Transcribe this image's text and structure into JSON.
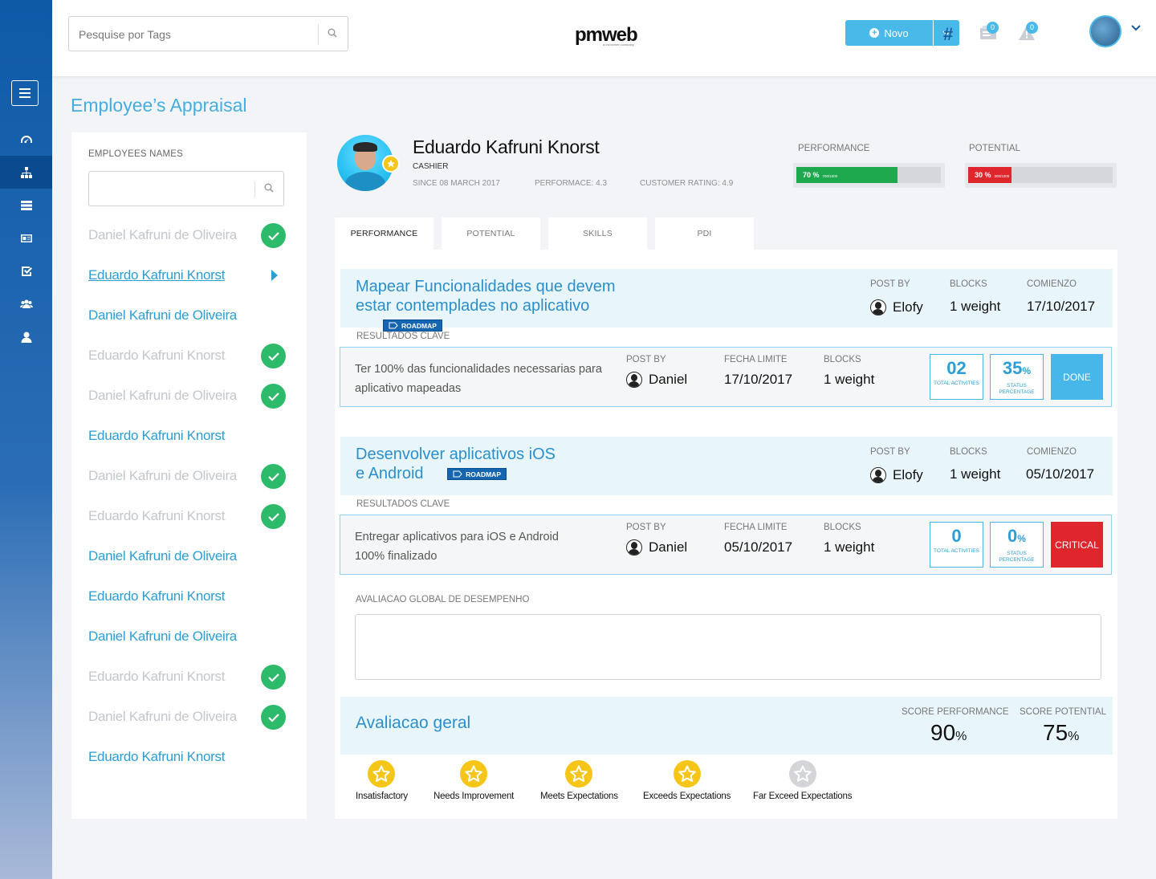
{
  "header": {
    "search_placeholder": "Pesquise por Tags",
    "logo": "pmweb",
    "logo_sub": "a Involvmen company",
    "new_button": "Novo",
    "hash": "#",
    "messages_count": "0",
    "alerts_count": "0"
  },
  "page": {
    "title": "Employee’s Appraisal"
  },
  "sidebar": {
    "items": [
      {
        "icon": "dashboard-icon"
      },
      {
        "icon": "org-chart-icon"
      },
      {
        "icon": "server-icon"
      },
      {
        "icon": "id-card-icon"
      },
      {
        "icon": "checklist-icon"
      },
      {
        "icon": "users-icon"
      },
      {
        "icon": "user-icon"
      }
    ]
  },
  "employees": {
    "label": "EMPLOYEES NAMES",
    "search_value": "",
    "list": [
      {
        "name": "Daniel Kafruni de Oliveira",
        "state": "done"
      },
      {
        "name": "Eduardo Kafruni Knorst",
        "state": "selected"
      },
      {
        "name": "Daniel Kafruni de Oliveira",
        "state": "active"
      },
      {
        "name": "Eduardo Kafruni Knorst",
        "state": "done"
      },
      {
        "name": "Daniel Kafruni de Oliveira",
        "state": "done"
      },
      {
        "name": "Eduardo Kafruni Knorst",
        "state": "active"
      },
      {
        "name": "Daniel Kafruni de Oliveira",
        "state": "done"
      },
      {
        "name": "Eduardo Kafruni Knorst",
        "state": "done"
      },
      {
        "name": "Daniel Kafruni de Oliveira",
        "state": "active"
      },
      {
        "name": "Eduardo Kafruni Knorst",
        "state": "active"
      },
      {
        "name": "Daniel Kafruni de Oliveira",
        "state": "active"
      },
      {
        "name": "Eduardo Kafruni Knorst",
        "state": "done"
      },
      {
        "name": "Daniel Kafruni de Oliveira",
        "state": "done"
      },
      {
        "name": "Eduardo Kafruni Knorst",
        "state": "active"
      }
    ]
  },
  "profile": {
    "name": "Eduardo Kafruni Knorst",
    "role": "CASHIER",
    "since": "SINCE 08 MARCH 2017",
    "performance": "PERFORMACE: 4.3",
    "customer_rating": "CUSTOMER RATING: 4.9",
    "performance_bar": {
      "label": "PERFORMANCE",
      "text": "70 %",
      "sub": "700/1000",
      "value": 0.7,
      "color": "#1fa94e"
    },
    "potential_bar": {
      "label": "POTENTIAL",
      "text": "30 %",
      "sub": "300/1000",
      "value": 0.3,
      "color": "#e0262d"
    }
  },
  "tabs": [
    {
      "label": "PERFORMANCE",
      "active": true
    },
    {
      "label": "POTENTIAL",
      "active": false
    },
    {
      "label": "SKILLS",
      "active": false
    },
    {
      "label": "PDI",
      "active": false
    }
  ],
  "objectives": [
    {
      "title": "Mapear Funcionalidades que devem estar contemplades no aplicativo",
      "tag": "ROADMAP",
      "post_by_label": "POST BY",
      "post_by": "Elofy",
      "blocks_label": "BLOCKS",
      "blocks": "1 weight",
      "start_label": "COMIENZO",
      "start": "17/10/2017",
      "results_label": "RESULTADOS CLAVE",
      "kr": {
        "text": "Ter 100% das funcionalidades necessarias para aplicativo mapeadas",
        "post_by_label": "POST BY",
        "post_by": "Daniel",
        "deadline_label": "FECHA LIMITE",
        "deadline": "17/10/2017",
        "blocks_label": "BLOCKS",
        "blocks": "1 weight",
        "activities": "02",
        "activities_cap": "TOTAL ACTIVITIES",
        "status_pct": "35",
        "status_cap": "STATUS PERCENTAGE",
        "status": "DONE",
        "status_color": "#46b7e8"
      }
    },
    {
      "title": "Desenvolver aplicativos iOS e Android",
      "tag": "ROADMAP",
      "post_by_label": "POST BY",
      "post_by": "Elofy",
      "blocks_label": "BLOCKS",
      "blocks": "1 weight",
      "start_label": "COMIENZO",
      "start": "05/10/2017",
      "results_label": "RESULTADOS CLAVE",
      "kr": {
        "text": "Entregar aplicativos para iOS e Android 100% finalizado",
        "post_by_label": "POST BY",
        "post_by": "Daniel",
        "deadline_label": "FECHA LIMITE",
        "deadline": "05/10/2017",
        "blocks_label": "BLOCKS",
        "blocks": "1 weight",
        "activities": "0",
        "activities_cap": "TOTAL ACTIVITIES",
        "status_pct": "0",
        "status_cap": "STATUS PERCENTAGE",
        "status": "CRITICAL",
        "status_color": "#e0262d"
      }
    }
  ],
  "global_eval": {
    "label": "AVALIACAO GLOBAL DE DESEMPENHO",
    "value": ""
  },
  "overall": {
    "title": "Avaliacao geral",
    "score_performance_label": "SCORE PERFORMANCE",
    "score_performance": "90",
    "score_potential_label": "SCORE POTENTIAL",
    "score_potential": "75",
    "percent": "%"
  },
  "rating": {
    "level": 4,
    "options": [
      "Insatisfactory",
      "Needs Improvement",
      "Meets Expectations",
      "Exceeds Expectations",
      "Far Exceed Expectations"
    ]
  }
}
